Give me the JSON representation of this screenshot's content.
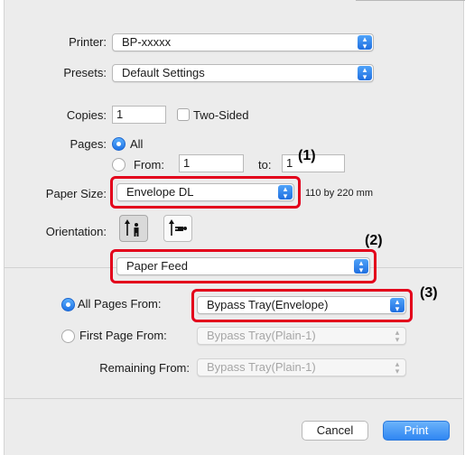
{
  "printer": {
    "label": "Printer:",
    "value": "BP-xxxxx"
  },
  "presets": {
    "label": "Presets:",
    "value": "Default Settings"
  },
  "copies": {
    "label": "Copies:",
    "value": "1",
    "two_sided_label": "Two-Sided",
    "two_sided_checked": false
  },
  "pages": {
    "label": "Pages:",
    "all_label": "All",
    "from_label": "From:",
    "from_value": "1",
    "to_label": "to:",
    "to_value": "1",
    "selected": "All"
  },
  "paper_size": {
    "label": "Paper Size:",
    "value": "Envelope DL",
    "dimensions": "110 by 220 mm"
  },
  "orientation": {
    "label": "Orientation:",
    "options": [
      "portrait-icon",
      "landscape-icon"
    ],
    "selected": "portrait"
  },
  "panel_menu": {
    "value": "Paper Feed"
  },
  "paper_feed": {
    "all_pages_label": "All Pages From:",
    "all_pages_value": "Bypass Tray(Envelope)",
    "first_page_label": "First Page From:",
    "first_page_value": "Bypass Tray(Plain-1)",
    "remaining_label": "Remaining From:",
    "remaining_value": "Bypass Tray(Plain-1)",
    "selected": "All Pages From"
  },
  "annotations": [
    "(1)",
    "(2)",
    "(3)"
  ],
  "buttons": {
    "cancel": "Cancel",
    "print": "Print"
  },
  "colors": {
    "highlight": "#e3001b",
    "accent": "#2f86f2"
  }
}
